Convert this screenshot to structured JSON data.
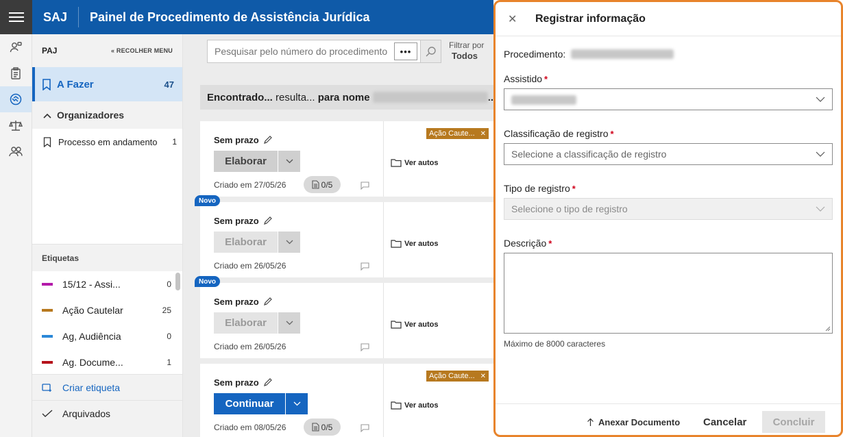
{
  "header": {
    "brand": "SAJ",
    "title": "Painel de Procedimento de Assistência Jurídica"
  },
  "rail": {
    "icons": [
      "menu-icon",
      "person-search-icon",
      "clipboard-icon",
      "handshake-icon",
      "scales-icon",
      "people-icon"
    ]
  },
  "sidebar": {
    "paj": "PAJ",
    "collapse_label": "« RECOLHER MENU",
    "todo": {
      "label": "A Fazer",
      "count": "47"
    },
    "organizers": {
      "label": "Organizadores"
    },
    "process_item": {
      "label": "Processo em andamento",
      "count": "1"
    },
    "tags_heading": "Etiquetas",
    "tags": [
      {
        "label": "15/12 - Assi...",
        "count": "0",
        "color": "#b31aa9"
      },
      {
        "label": "Ação Cautelar",
        "count": "25",
        "color": "#b7791f"
      },
      {
        "label": "Ag, Audiência",
        "count": "0",
        "color": "#2b88d8"
      },
      {
        "label": "Ag. Docume...",
        "count": "1",
        "color": "#b5121b"
      }
    ],
    "create_tag": "Criar etiqueta",
    "archived": "Arquivados"
  },
  "main": {
    "search_placeholder": "Pesquisar pelo número do procedimento",
    "more_label": "•••",
    "filter_label": "Filtrar por",
    "filter_value": "Todos",
    "result_found": "Encontrado...",
    "result_text": "resulta...",
    "result_name": "para nome",
    "result_ellipsis": "..",
    "cards": [
      {
        "prazo": "Sem prazo",
        "button": "Elaborar",
        "created": "Criado em 27/05/26",
        "docs": "0/5",
        "tag": "Ação Caute...",
        "ver": "Ver autos"
      },
      {
        "prazo": "Sem prazo",
        "button": "Elaborar",
        "created": "Criado em 26/05/26",
        "ver": "Ver autos",
        "novo": "Novo"
      },
      {
        "prazo": "Sem prazo",
        "button": "Elaborar",
        "created": "Criado em 26/05/26",
        "ver": "Ver autos",
        "novo": "Novo"
      },
      {
        "prazo": "Sem prazo",
        "button": "Continuar",
        "created": "Criado em 08/05/26",
        "docs": "0/5",
        "tag": "Ação Caute...",
        "ver": "Ver autos"
      }
    ]
  },
  "panel": {
    "title": "Registrar informação",
    "procedimento_label": "Procedimento:",
    "assistido_label": "Assistido",
    "classificacao_label": "Classificação de registro",
    "classificacao_placeholder": "Selecione a classificação de registro",
    "tipo_label": "Tipo de registro",
    "tipo_placeholder": "Selecione o tipo de registro",
    "descricao_label": "Descrição",
    "max_hint": "Máximo de 8000 caracteres",
    "required_mark": "*",
    "anexar": "Anexar Documento",
    "cancelar": "Cancelar",
    "concluir": "Concluir"
  },
  "colors": {
    "brand_blue": "#0f5aa8",
    "accent_blue": "#1565c0",
    "panel_border": "#e8842c",
    "tag_orange": "#b7791f"
  }
}
